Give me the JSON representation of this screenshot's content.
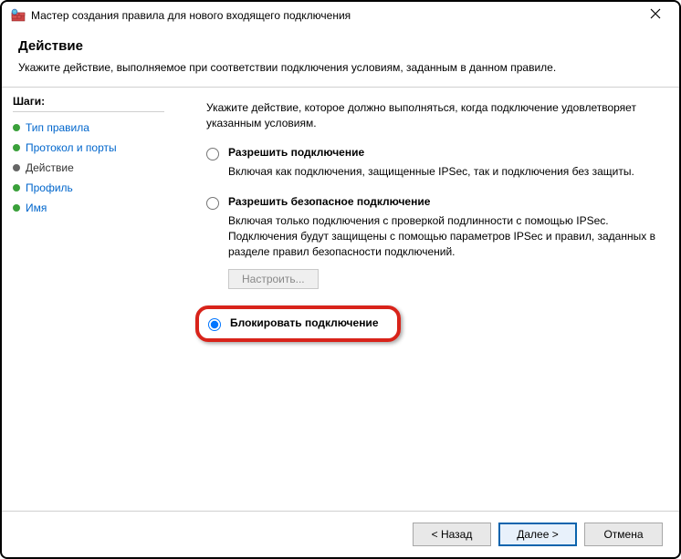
{
  "window": {
    "title": "Мастер создания правила для нового входящего подключения"
  },
  "header": {
    "title": "Действие",
    "subtitle": "Укажите действие, выполняемое при соответствии подключения условиям, заданным в данном правиле."
  },
  "steps": {
    "title": "Шаги:",
    "items": [
      {
        "label": "Тип правила"
      },
      {
        "label": "Протокол и порты"
      },
      {
        "label": "Действие"
      },
      {
        "label": "Профиль"
      },
      {
        "label": "Имя"
      }
    ],
    "current_index": 2
  },
  "content": {
    "intro": "Укажите действие, которое должно выполняться, когда подключение удовлетворяет указанным условиям.",
    "options": [
      {
        "label": "Разрешить подключение",
        "desc": "Включая как подключения, защищенные IPSec, так и подключения без защиты."
      },
      {
        "label": "Разрешить безопасное подключение",
        "desc": "Включая только подключения с проверкой подлинности с помощью IPSec. Подключения будут защищены с помощью параметров IPSec и правил, заданных в разделе правил безопасности подключений."
      },
      {
        "label": "Блокировать подключение",
        "desc": ""
      }
    ],
    "configure_label": "Настроить...",
    "selected_index": 2
  },
  "footer": {
    "back": "< Назад",
    "next": "Далее >",
    "cancel": "Отмена"
  }
}
